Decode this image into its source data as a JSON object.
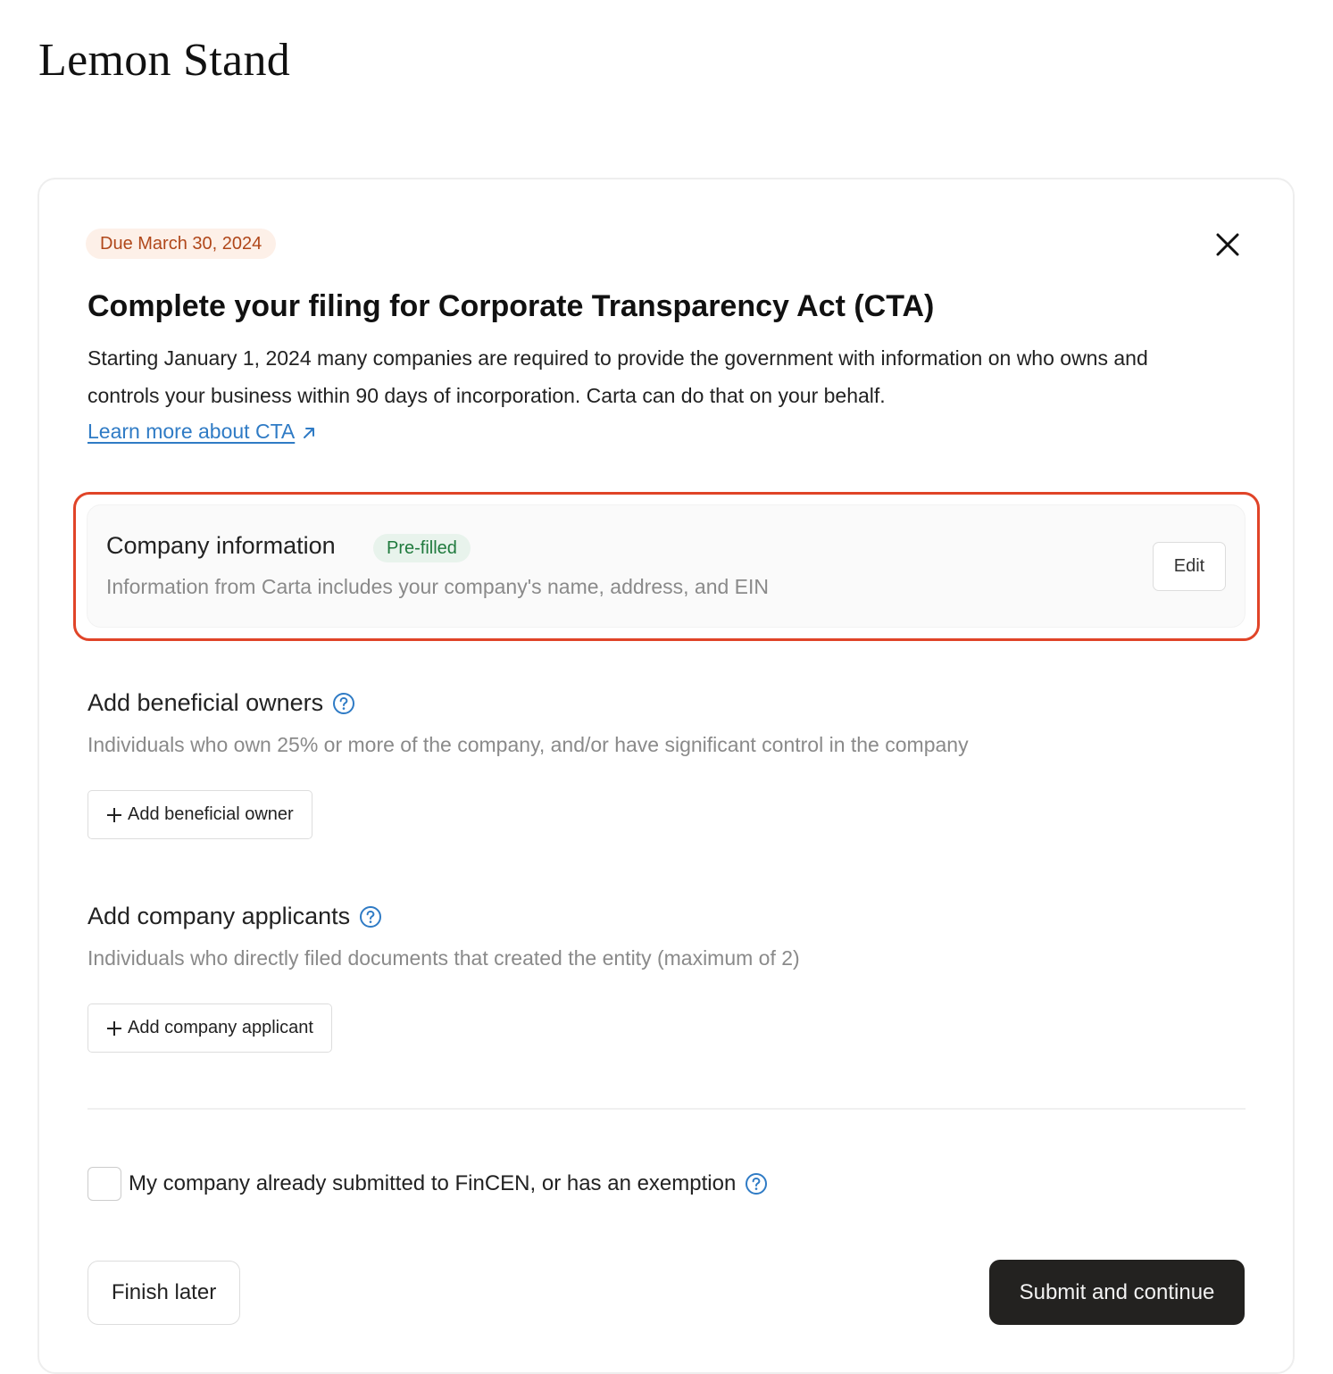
{
  "header": {
    "company_name": "Lemon Stand"
  },
  "card": {
    "due_badge": "Due March 30, 2024",
    "close_icon": "close-icon",
    "title": "Complete your filing for Corporate Transparency Act (CTA)",
    "intro_text": "Starting January 1, 2024 many companies are required to provide the government with information on who owns and controls your business within 90 days of incorporation. Carta can do that on your behalf.",
    "learn_more_link": "Learn more about CTA",
    "learn_more_icon": "external-link-arrow-icon"
  },
  "company_info": {
    "title": "Company information",
    "badge": "Pre-filled",
    "description": "Information from Carta includes your company's name, address, and EIN",
    "edit_label": "Edit"
  },
  "beneficial_owners": {
    "title": "Add beneficial owners",
    "help_icon": "question-circle-icon",
    "description": "Individuals who own 25% or more of the company, and/or have significant control in the company",
    "button_label": "Add beneficial owner"
  },
  "company_applicants": {
    "title": "Add company applicants",
    "help_icon": "question-circle-icon",
    "description": "Individuals who directly filed documents that created the entity (maximum of 2)",
    "button_label": "Add company applicant"
  },
  "exemption": {
    "checked": false,
    "label": "My company already submitted to FinCEN, or has an exemption",
    "help_icon": "question-circle-icon"
  },
  "footer": {
    "finish_later_label": "Finish later",
    "submit_label": "Submit and continue"
  },
  "colors": {
    "due_badge_bg": "#fdf0e8",
    "due_badge_text": "#b0471a",
    "prefilled_badge_bg": "#e8f3ec",
    "prefilled_badge_text": "#1f7a3d",
    "link": "#2f7bc5",
    "highlight_border": "#e04428",
    "primary_button": "#232220"
  }
}
